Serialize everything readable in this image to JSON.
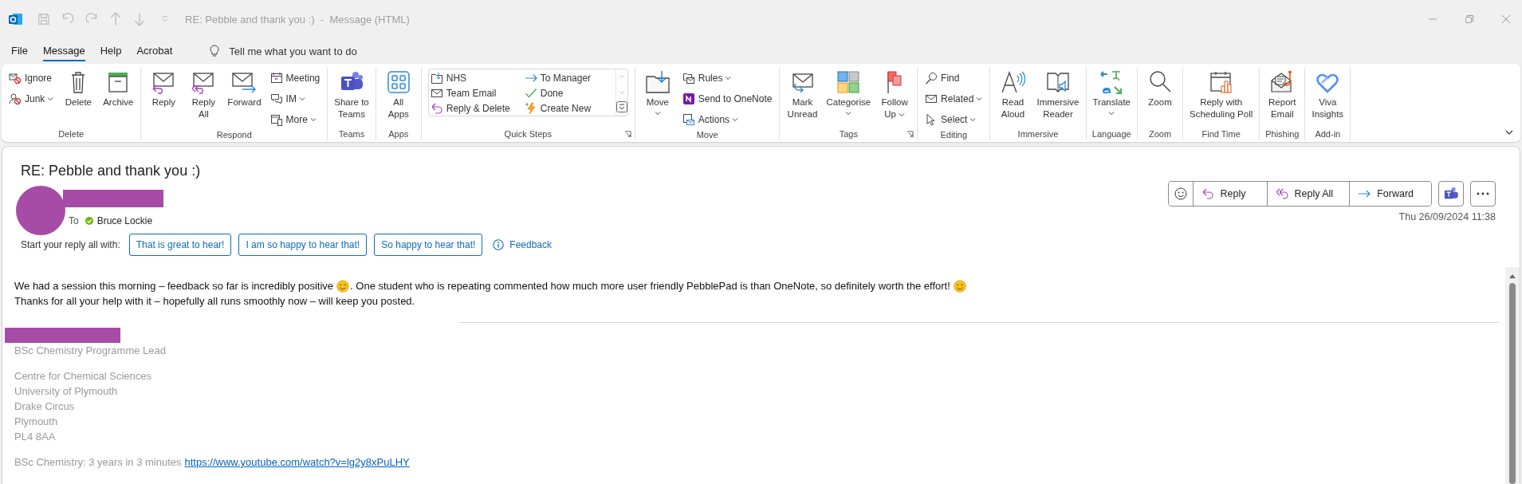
{
  "window": {
    "title": "RE: Pebble and thank you :)  -  Message (HTML)"
  },
  "menu_tabs": [
    {
      "label": "File",
      "selected": false
    },
    {
      "label": "Message",
      "selected": true
    },
    {
      "label": "Help",
      "selected": false
    },
    {
      "label": "Acrobat",
      "selected": false
    }
  ],
  "tell_me": {
    "placeholder": "Tell me what you want to do"
  },
  "ribbon": {
    "groups": [
      {
        "label": "Delete",
        "launcher": false,
        "items": [
          {
            "kind": "stack",
            "entries": [
              {
                "label": "Ignore",
                "dropdown": false
              },
              {
                "label": "Junk",
                "dropdown": true
              }
            ]
          },
          {
            "kind": "large",
            "lines": [
              "Delete"
            ],
            "dropdown": false
          },
          {
            "kind": "large",
            "lines": [
              "Archive"
            ],
            "dropdown": false
          }
        ]
      },
      {
        "label": "Respond",
        "launcher": false,
        "items": [
          {
            "kind": "large",
            "lines": [
              "Reply"
            ],
            "dropdown": false
          },
          {
            "kind": "large",
            "lines": [
              "Reply",
              "All"
            ],
            "dropdown": false
          },
          {
            "kind": "large",
            "lines": [
              "Forward"
            ],
            "dropdown": false
          },
          {
            "kind": "stack",
            "entries": [
              {
                "label": "Meeting",
                "dropdown": false
              },
              {
                "label": "IM",
                "dropdown": true
              },
              {
                "label": "More",
                "dropdown": true
              }
            ]
          }
        ]
      },
      {
        "label": "Teams",
        "launcher": false,
        "items": [
          {
            "kind": "large",
            "lines": [
              "Share to",
              "Teams"
            ],
            "dropdown": false
          }
        ]
      },
      {
        "label": "Apps",
        "launcher": false,
        "items": [
          {
            "kind": "large",
            "lines": [
              "All",
              "Apps"
            ],
            "dropdown": false
          }
        ]
      },
      {
        "label": "Quick Steps",
        "launcher": true,
        "items": [
          {
            "kind": "gallery",
            "entries": [
              {
                "label": "NHS"
              },
              {
                "label": "Team Email"
              },
              {
                "label": "Reply & Delete"
              },
              {
                "label": "To Manager"
              },
              {
                "label": "Done"
              },
              {
                "label": "Create New"
              }
            ]
          }
        ]
      },
      {
        "label": "Move",
        "launcher": false,
        "items": [
          {
            "kind": "large",
            "lines": [
              "Move"
            ],
            "dropdown": true
          },
          {
            "kind": "stack",
            "entries": [
              {
                "label": "Rules",
                "dropdown": true
              },
              {
                "label": "Send to OneNote",
                "dropdown": false
              },
              {
                "label": "Actions",
                "dropdown": true
              }
            ]
          }
        ]
      },
      {
        "label": "Tags",
        "launcher": true,
        "items": [
          {
            "kind": "large",
            "lines": [
              "Mark",
              "Unread"
            ],
            "dropdown": false
          },
          {
            "kind": "large",
            "lines": [
              "Categorise"
            ],
            "dropdown": true
          },
          {
            "kind": "large",
            "lines": [
              "Follow",
              "Up"
            ],
            "dropdown": true
          }
        ]
      },
      {
        "label": "Editing",
        "launcher": false,
        "items": [
          {
            "kind": "stack",
            "entries": [
              {
                "label": "Find",
                "dropdown": false
              },
              {
                "label": "Related",
                "dropdown": true
              },
              {
                "label": "Select",
                "dropdown": true
              }
            ]
          }
        ]
      },
      {
        "label": "Immersive",
        "launcher": false,
        "items": [
          {
            "kind": "large",
            "lines": [
              "Read",
              "Aloud"
            ],
            "dropdown": false
          },
          {
            "kind": "large",
            "lines": [
              "Immersive",
              "Reader"
            ],
            "dropdown": false
          }
        ]
      },
      {
        "label": "Language",
        "launcher": false,
        "items": [
          {
            "kind": "large",
            "lines": [
              "Translate"
            ],
            "dropdown": true
          }
        ]
      },
      {
        "label": "Zoom",
        "launcher": false,
        "items": [
          {
            "kind": "large",
            "lines": [
              "Zoom"
            ],
            "dropdown": false
          }
        ]
      },
      {
        "label": "Find Time",
        "launcher": false,
        "items": [
          {
            "kind": "large",
            "lines": [
              "Reply with",
              "Scheduling Poll"
            ],
            "dropdown": false
          }
        ]
      },
      {
        "label": "Phishing",
        "launcher": false,
        "items": [
          {
            "kind": "large",
            "lines": [
              "Report",
              "Email"
            ],
            "dropdown": false
          }
        ]
      },
      {
        "label": "Add-in",
        "launcher": false,
        "items": [
          {
            "kind": "large",
            "lines": [
              "Viva",
              "Insights"
            ],
            "dropdown": false
          }
        ]
      }
    ]
  },
  "message": {
    "subject": "RE: Pebble and thank you :)",
    "to_label": "To",
    "recipient": "Bruce Lockie",
    "actions": [
      {
        "label": "Reply"
      },
      {
        "label": "Reply All"
      },
      {
        "label": "Forward"
      }
    ],
    "date": "Thu 26/09/2024 11:38",
    "suggested_replies": {
      "prompt": "Start your reply all with:",
      "options": [
        "That is great to hear!",
        "I am so happy to hear that!",
        "So happy to hear that!"
      ],
      "feedback": "Feedback"
    },
    "body": [
      {
        "parts": [
          {
            "kind": "text",
            "text": "We had a session this morning – feedback so far is incredibly positive"
          },
          {
            "kind": "emoji"
          },
          {
            "kind": "text",
            "text": ". One student who is repeating commented how much more user friendly PebblePad is than OneNote, so definitely worth the effort!"
          },
          {
            "kind": "emoji"
          }
        ]
      },
      {
        "parts": [
          {
            "kind": "text",
            "text": "Thanks for all your help with it – hopefully all runs smoothly now – will keep you posted."
          }
        ]
      }
    ],
    "signature": {
      "blocks": [
        [
          "BSc Chemistry Programme Lead"
        ],
        [
          "Centre for Chemical Sciences",
          "University of Plymouth",
          "Drake Circus",
          "Plymouth",
          "PL4 8AA"
        ]
      ],
      "video_line": {
        "text": "BSc Chemistry: 3 years in 3 minutes",
        "link": "https://www.youtube.com/watch?v=lg2y8xPuLHY"
      }
    }
  }
}
